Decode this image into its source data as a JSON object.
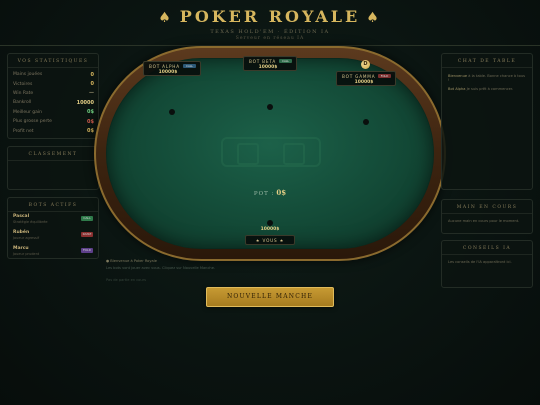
{
  "header": {
    "title": "POKER ROYALE",
    "subtitle": "TEXAS HOLD'EM · ÉDITION IA",
    "subtitle2": "Serveur en réseau IA"
  },
  "stats": {
    "title": "VOS STATISTIQUES",
    "rows": [
      {
        "label": "Mains jouées",
        "value": "0",
        "color": "#d6b65e"
      },
      {
        "label": "Victoires",
        "value": "0",
        "color": "#d6b65e"
      },
      {
        "label": "Win Rate",
        "value": "—",
        "color": "#9a9070"
      },
      {
        "label": "Bankroll",
        "value": "10000",
        "color": "#e2cd84"
      },
      {
        "label": "Meilleur gain",
        "value": "0$",
        "color": "#6fce7f"
      },
      {
        "label": "Plus grosse perte",
        "value": "0$",
        "color": "#d25c4e"
      },
      {
        "label": "Profit net",
        "value": "0$",
        "color": "#d6b65e"
      }
    ]
  },
  "leaderboard": {
    "title": "CLASSEMENT"
  },
  "ai_players": {
    "title": "BOTS ACTIFS",
    "items": [
      {
        "name": "Pascal",
        "sub": "Stratégie équilibrée",
        "tag": "CALL",
        "tag_color": "#2f7a4a"
      },
      {
        "name": "Rubén",
        "sub": "Joueur agressif",
        "tag": "RAISE",
        "tag_color": "#8a2f2f"
      },
      {
        "name": "Marcu",
        "sub": "Joueur prudent",
        "tag": "FOLD",
        "tag_color": "#5d3f8a"
      }
    ]
  },
  "table": {
    "pot_label": "POT :",
    "pot_value": "0$",
    "seats": {
      "alpha": {
        "name": "BOT ALPHA",
        "chips": "10000$",
        "badge": "CALL",
        "badge_color": "#2d5a78"
      },
      "beta": {
        "name": "BOT BETA",
        "chips": "10000$",
        "badge": "CALL",
        "badge_color": "#2e6b4a"
      },
      "gamma": {
        "name": "BOT GAMMA",
        "chips": "10000$",
        "badge": "FOLD",
        "badge_color": "#7a2f2f"
      },
      "you": {
        "name": "★ VOUS ★",
        "chips": "10000$"
      }
    },
    "dealer_label": "D"
  },
  "log": {
    "line1": "● Bienvenue à Poker Royale",
    "line2": "Les bots vont jouer avec vous. Cliquez sur Nouvelle Manche.",
    "line3": "Pas de partie en cours"
  },
  "new_round_button": "NOUVELLE MANCHE",
  "chat": {
    "title": "CHAT DE TABLE",
    "line1_name": "Bienvenue",
    "line1_text": "à la table. Bonne chance à tous !",
    "line2_name": "Bot Alpha",
    "line2_text": "Je suis prêt à commencer."
  },
  "last_hand": {
    "title": "MAIN EN COURS",
    "text": "Aucune main en cours pour le moment."
  },
  "ai_advice": {
    "title": "CONSEILS IA",
    "text": "Les conseils de l'IA apparaîtront ici."
  }
}
